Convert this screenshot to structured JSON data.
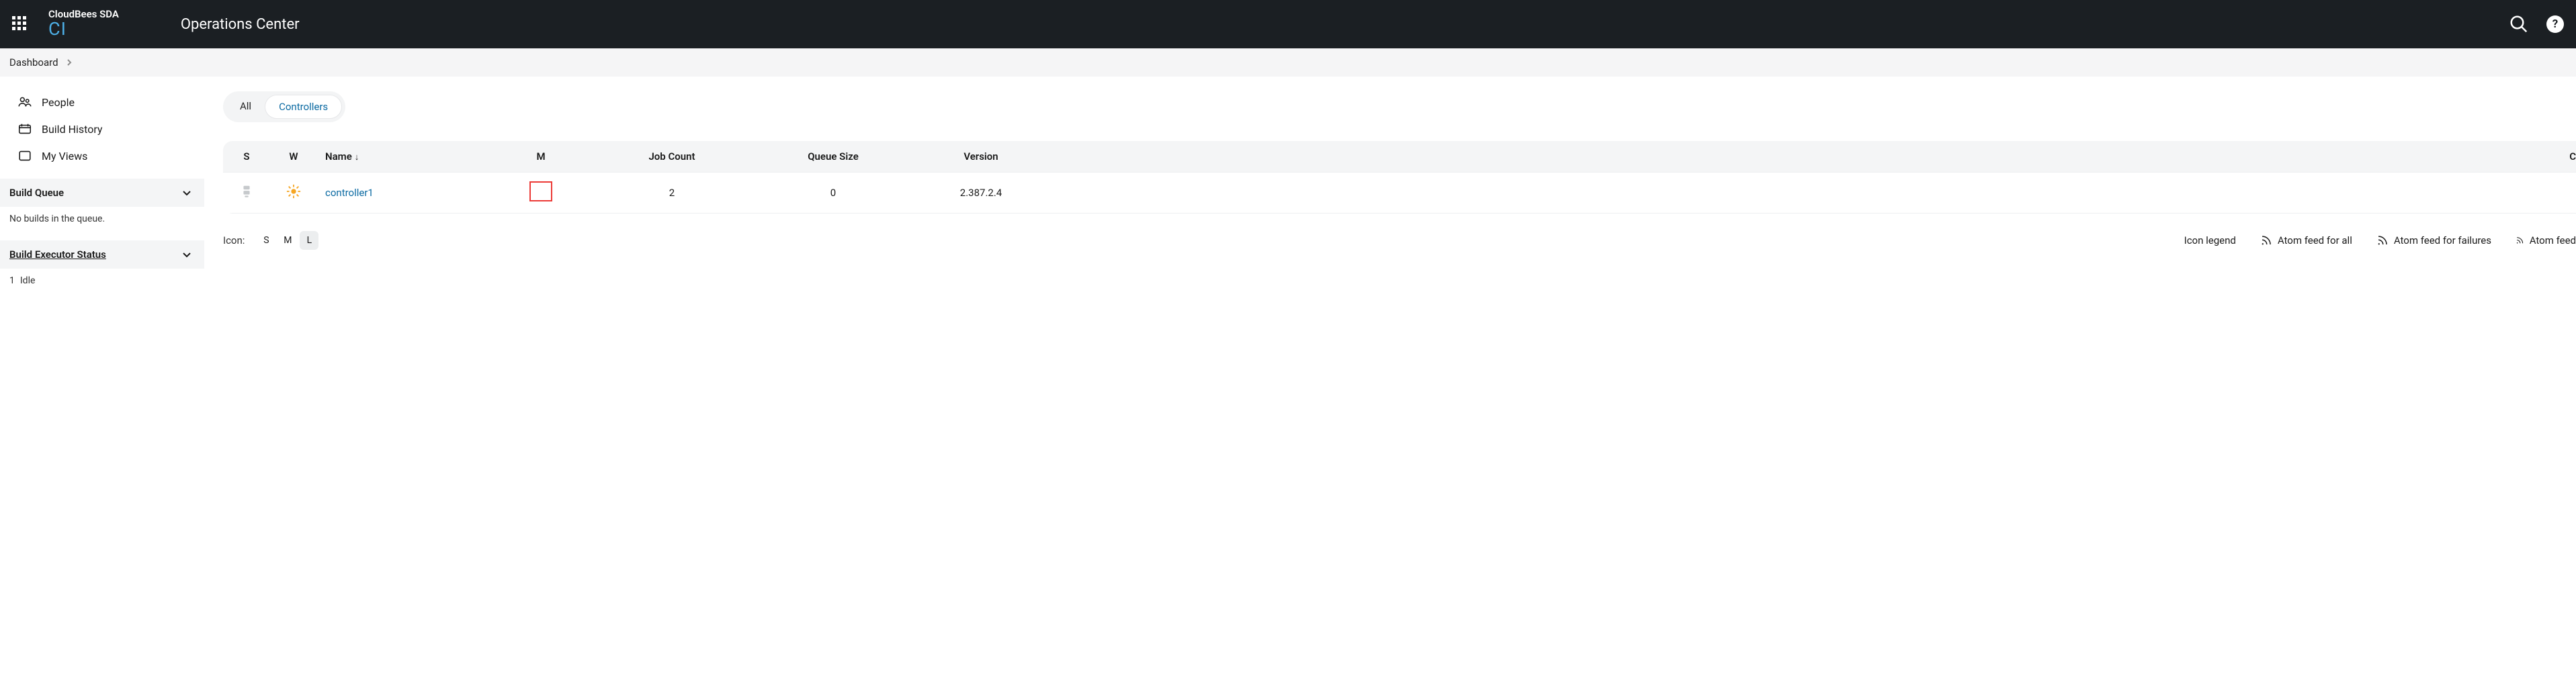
{
  "header": {
    "brand_top": "CloudBees SDA",
    "brand_sub": "CI",
    "title": "Operations Center"
  },
  "breadcrumb": {
    "root": "Dashboard"
  },
  "sidebar": {
    "people": "People",
    "build_history": "Build History",
    "my_views": "My Views",
    "build_queue": {
      "title": "Build Queue",
      "empty": "No builds in the queue."
    },
    "build_executor": {
      "title": "Build Executor Status",
      "row_index": "1",
      "row_state": "Idle"
    }
  },
  "tabs": {
    "all": "All",
    "controllers": "Controllers"
  },
  "table": {
    "headers": {
      "s": "S",
      "w": "W",
      "name": "Name",
      "m": "M",
      "job_count": "Job Count",
      "queue_size": "Queue Size",
      "version": "Version",
      "cut": "C"
    },
    "row0": {
      "name": "controller1",
      "job_count": "2",
      "queue_size": "0",
      "version": "2.387.2.4"
    }
  },
  "footer": {
    "icon_label": "Icon:",
    "size_s": "S",
    "size_m": "M",
    "size_l": "L",
    "legend": "Icon legend",
    "atom_all": "Atom feed for all",
    "atom_fail": "Atom feed for failures",
    "atom_cut": "Atom feed"
  }
}
